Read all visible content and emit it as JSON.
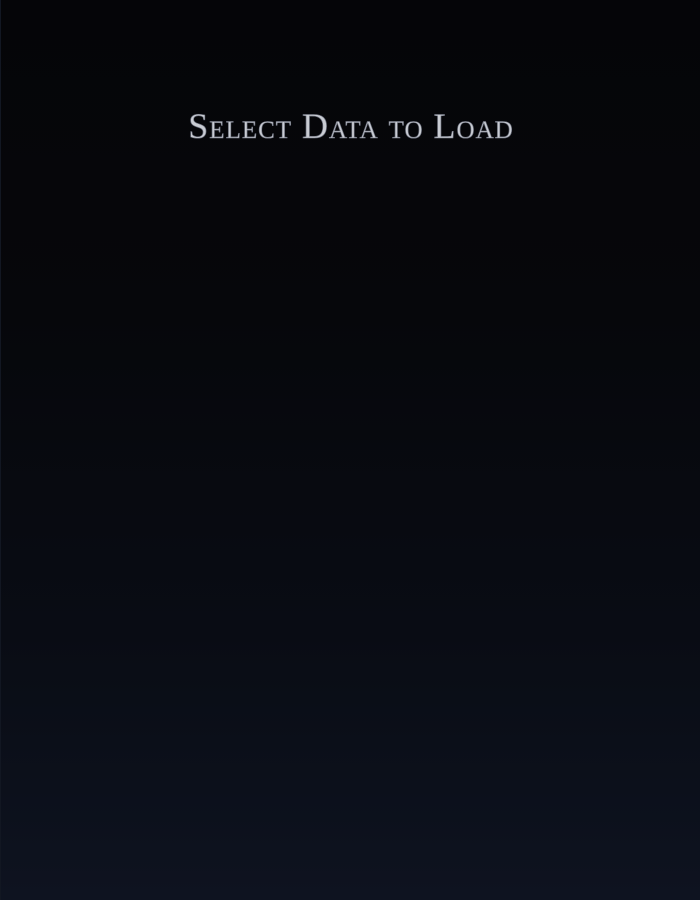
{
  "screen": {
    "title": "Select Data to Load",
    "colors": {
      "background_top": "#050508",
      "background_bottom": "#0e1320",
      "title_text": "#c9ccd3"
    }
  }
}
